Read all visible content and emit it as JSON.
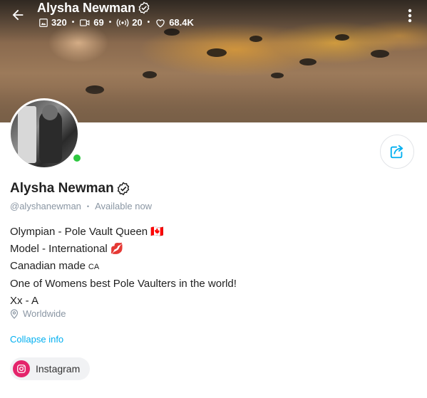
{
  "header": {
    "title": "Alysha Newman",
    "stats": {
      "photos": "320",
      "videos": "69",
      "streams": "20",
      "likes": "68.4K"
    }
  },
  "profile": {
    "name": "Alysha Newman",
    "handle": "@alyshanewman",
    "status": "Available now",
    "online_color": "#2ec840",
    "bio": [
      "Olympian - Pole Vault Queen 🇨🇦",
      "Model - International 💋",
      "Canadian made",
      "One of Womens best Pole Vaulters in the world!",
      "Xx - A"
    ],
    "bio_flag_text": "CA",
    "location": "Worldwide",
    "collapse_label": "Collapse info",
    "socials": [
      {
        "label": "Instagram",
        "icon": "instagram-icon",
        "color": "#e4246b"
      }
    ]
  },
  "theme": {
    "accent": "#00aff0",
    "muted": "#8a96a3"
  }
}
